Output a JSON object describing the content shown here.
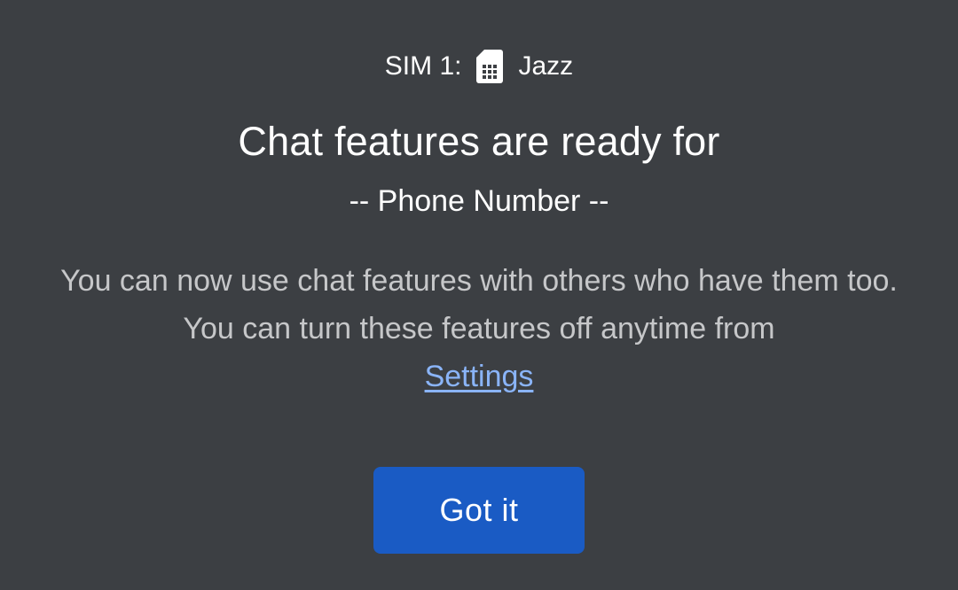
{
  "dialog": {
    "sim_label": "SIM 1:",
    "sim_icon": "sim-card-icon",
    "carrier": "Jazz",
    "title": "Chat features are ready for",
    "phone_number": "-- Phone Number --",
    "body_text": "You can now use chat features with others who have them too. You can turn these features off anytime from",
    "settings_link": "Settings",
    "button_label": "Got it"
  },
  "colors": {
    "background": "#3c3f43",
    "button": "#1a5bc4",
    "link": "#8ab4f8",
    "body_text": "#c6c7c9"
  }
}
